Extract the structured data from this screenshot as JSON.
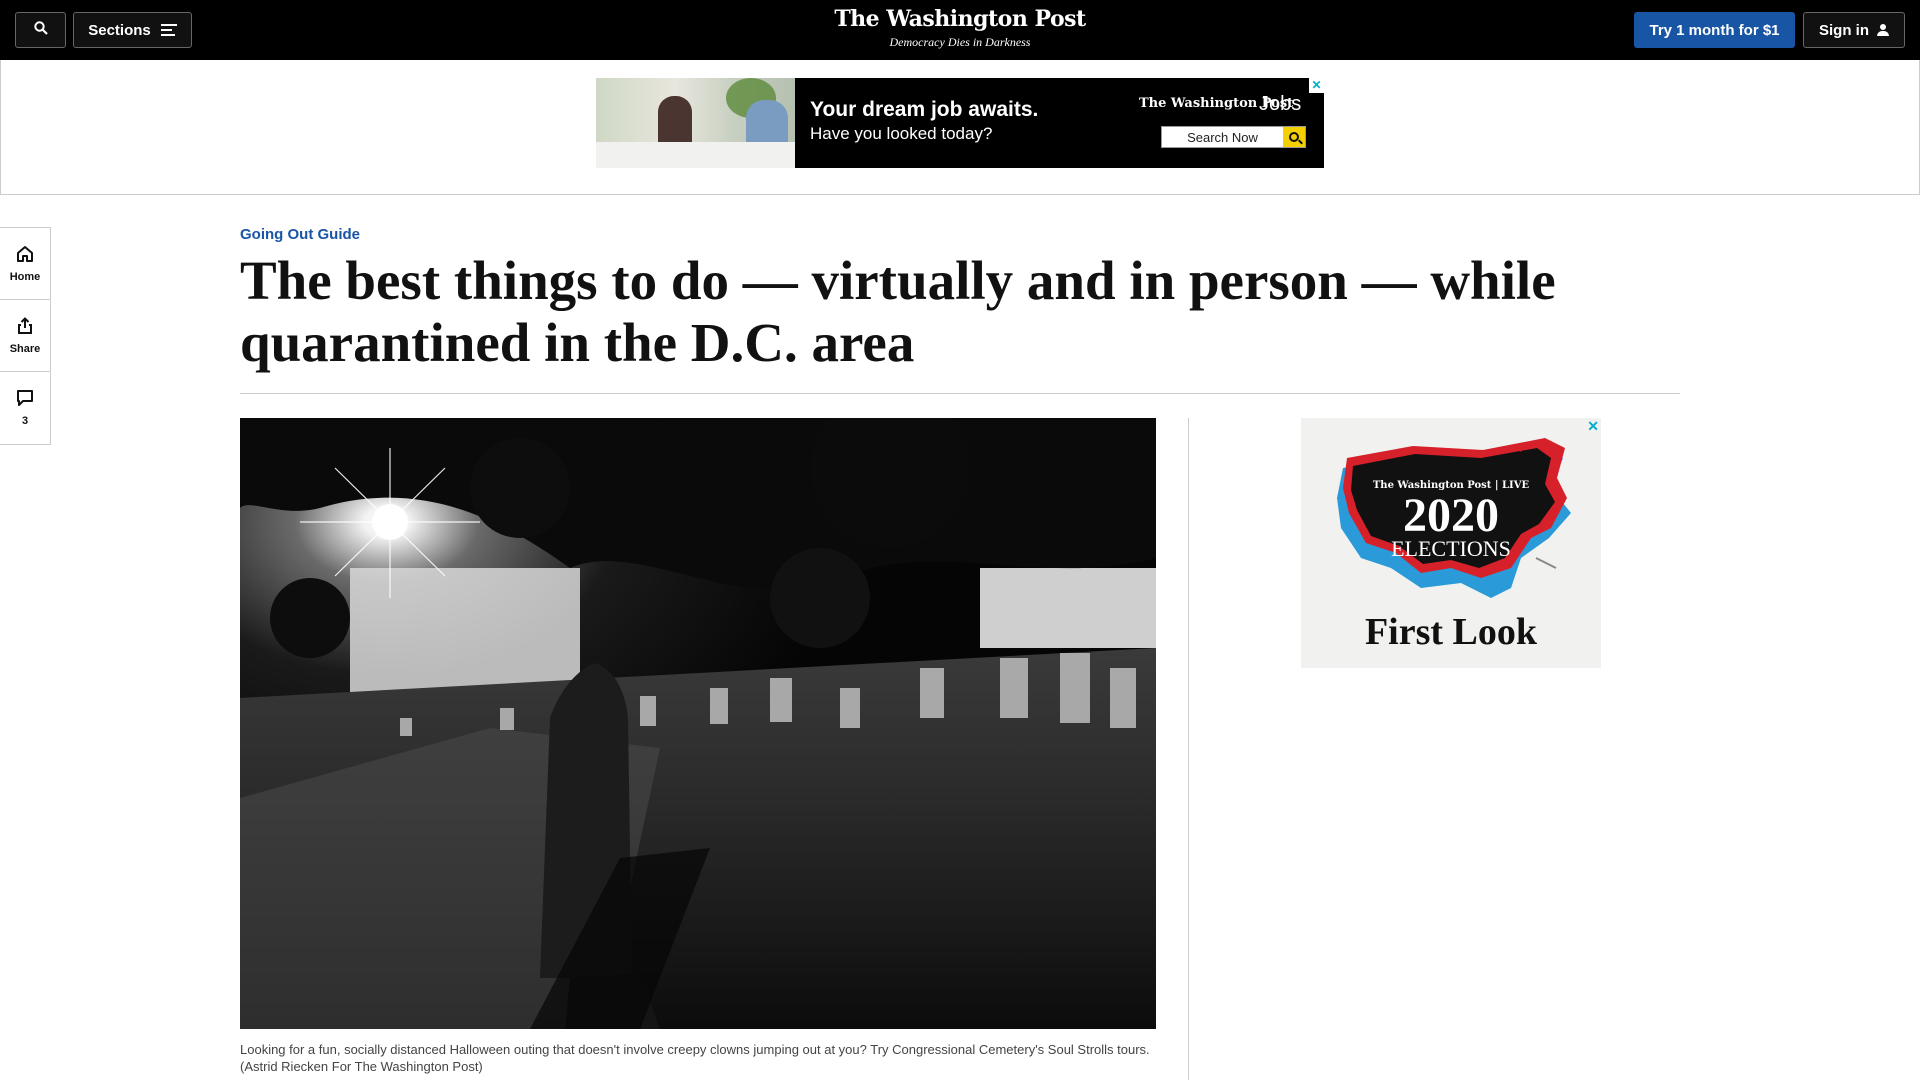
{
  "header": {
    "sections_label": "Sections",
    "logo_text": "The Washington Post",
    "tagline": "Democracy Dies in Darkness",
    "subscribe_label": "Try 1 month for $1",
    "signin_label": "Sign in"
  },
  "top_ad": {
    "headline": "Your dream job awaits.",
    "subheadline": "Have you looked today?",
    "brand": "The Washington Post",
    "brand_suffix": "Jobs",
    "search_button": "Search Now",
    "adchoices_mark": "✕"
  },
  "rail": {
    "home_label": "Home",
    "share_label": "Share",
    "comments_count": "3"
  },
  "article": {
    "kicker": "Going Out Guide",
    "headline": "The best things to do — virtually and in person — while quarantined in the D.C. area",
    "caption": "Looking for a fun, socially distanced Halloween outing that doesn't involve creepy clowns jumping out at you? Try Congressional Cemetery's Soul Strolls tours. (Astrid Riecken For The Washington Post)"
  },
  "side_ad": {
    "brand": "The Washington Post | LIVE",
    "year": "2020",
    "title": "ELECTIONS",
    "tagline": "First Look",
    "close_mark": "✕"
  },
  "colors": {
    "accent_blue": "#1955a5",
    "header_black": "#000000",
    "ad_red": "#d6212b",
    "ad_blue": "#2a9ad8"
  }
}
